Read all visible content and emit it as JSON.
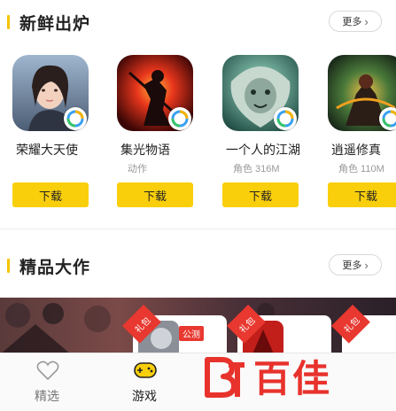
{
  "sections": {
    "new_releases": {
      "title": "新鲜出炉",
      "more_label": "更多"
    },
    "featured": {
      "title": "精品大作",
      "more_label": "更多"
    }
  },
  "games": [
    {
      "name": "荣耀大天使",
      "meta": "",
      "download_label": "下载",
      "icon": "angel-character-icon"
    },
    {
      "name": "集光物语",
      "meta": "动作",
      "download_label": "下载",
      "icon": "red-warrior-icon"
    },
    {
      "name": "一个人的江湖",
      "meta": "角色 316M",
      "download_label": "下载",
      "icon": "lion-warrior-icon"
    },
    {
      "name": "逍遥修真",
      "meta": "角色 110M",
      "download_label": "下载",
      "icon": "fire-warrior-icon"
    }
  ],
  "promo": {
    "gift_label": "礼包",
    "beta_label": "公测"
  },
  "bottom_nav": [
    {
      "label": "精选",
      "icon": "heart-icon",
      "active": false
    },
    {
      "label": "游戏",
      "icon": "gamepad-icon",
      "active": true
    }
  ],
  "watermark": {
    "text": "百佳"
  },
  "colors": {
    "accent": "#f9cf0c",
    "tag_red": "#e8382f",
    "watermark_red": "#e8322c"
  }
}
